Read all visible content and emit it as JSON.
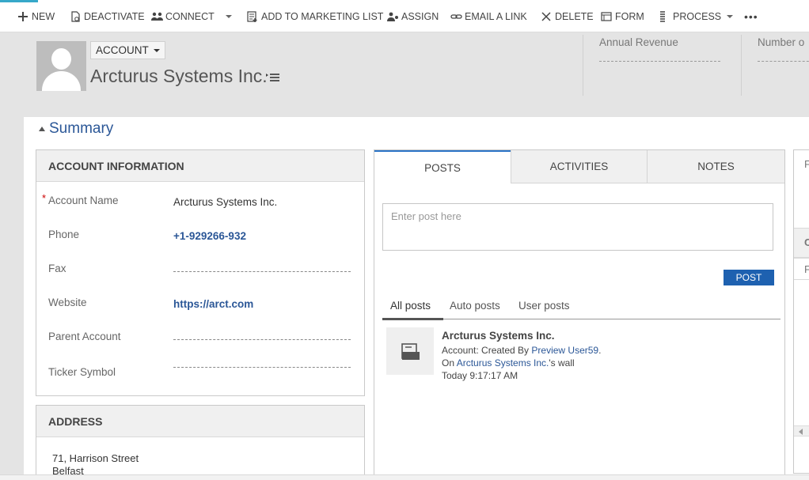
{
  "command_bar": {
    "new": "NEW",
    "deactivate": "DEACTIVATE",
    "connect": "CONNECT",
    "add_to_marketing_list": "ADD TO MARKETING LIST",
    "assign": "ASSIGN",
    "email_a_link": "EMAIL A LINK",
    "delete": "DELETE",
    "form": "FORM",
    "process": "PROCESS",
    "more": "•••"
  },
  "header": {
    "entity_label": "ACCOUNT",
    "record_name": "Arcturus Systems Inc.",
    "fields": [
      {
        "label": "Annual Revenue"
      },
      {
        "label": "Number o"
      }
    ]
  },
  "summary": {
    "title": "Summary"
  },
  "account_info": {
    "title": "ACCOUNT INFORMATION",
    "account_name_label": "Account Name",
    "account_name_value": "Arcturus Systems Inc.",
    "phone_label": "Phone",
    "phone_value": "+1-929266-932",
    "fax_label": "Fax",
    "website_label": "Website",
    "website_value": "https://arct.com",
    "parent_account_label": "Parent Account",
    "ticker_symbol_label": "Ticker Symbol"
  },
  "address": {
    "title": "ADDRESS",
    "street": "71, Harrison Street",
    "city": "Belfast"
  },
  "social": {
    "tabs": [
      "POSTS",
      "ACTIVITIES",
      "NOTES"
    ],
    "post_placeholder": "Enter post here",
    "post_button": "POST",
    "subtabs": [
      "All posts",
      "Auto posts",
      "User posts"
    ],
    "post": {
      "title": "Arcturus Systems Inc.",
      "line1_prefix": "Account: Created By ",
      "line1_link": "Preview User59",
      "line1_suffix": ".",
      "line2_prefix": "On ",
      "line2_link": "Arcturus Systems Inc.",
      "line2_suffix": "'s wall",
      "time": "Today 9:17:17 AM"
    }
  },
  "right_panel": {
    "letters": [
      "F",
      "C",
      "F"
    ]
  },
  "colors": {
    "accent": "#2b5797",
    "post_button": "#1e61b0",
    "top_accent": "#36a8c9"
  }
}
